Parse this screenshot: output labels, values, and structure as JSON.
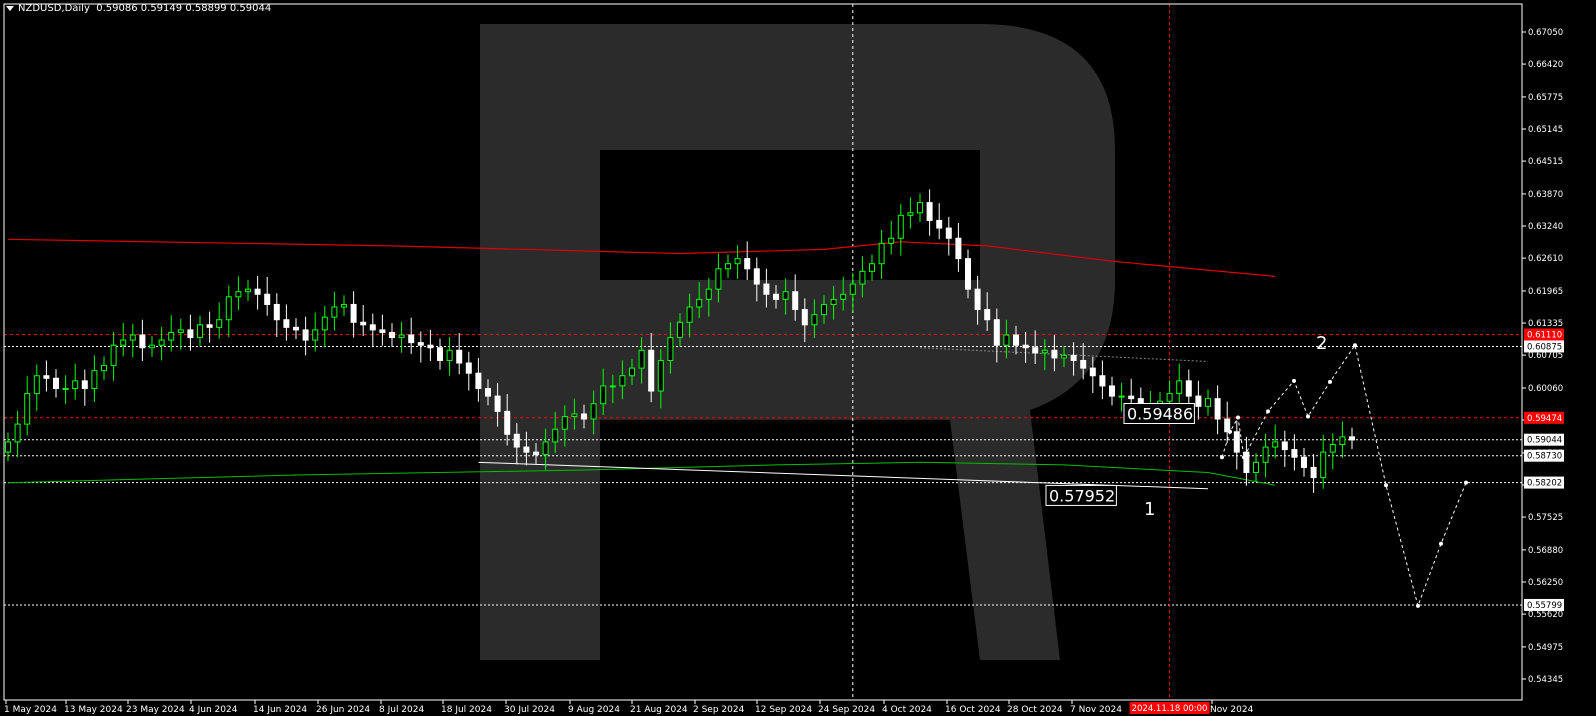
{
  "header": {
    "symbol": "NZDUSD,Daily",
    "ohlc": "0.59086 0.59149 0.58899 0.59044"
  },
  "colors": {
    "background": "#000000",
    "bull_candle": "#00ff00",
    "bear_candle": "#ffffff",
    "ma_long": "#e00000",
    "ma_mid": "#00c000",
    "red_level": "#ff0000",
    "axis_text": "#ffffff",
    "watermark": "#2b2b2b"
  },
  "chart_data": {
    "type": "candlestick",
    "ylim": [
      0.54345,
      0.6705
    ],
    "y_ticks": [
      "0.67050",
      "0.66420",
      "0.65775",
      "0.65145",
      "0.64515",
      "0.63870",
      "0.63240",
      "0.62610",
      "0.61965",
      "0.61335",
      "0.60705",
      "0.60060",
      "0.59430",
      "0.58785",
      "0.58155",
      "0.57525",
      "0.56880",
      "0.56250",
      "0.55620",
      "0.54975",
      "0.54345"
    ],
    "x_ticks": [
      "1 May 2024",
      "13 May 2024",
      "23 May 2024",
      "4 Jun 2024",
      "14 Jun 2024",
      "26 Jun 2024",
      "8 Jul 2024",
      "18 Jul 2024",
      "30 Jul 2024",
      "9 Aug 2024",
      "21 Aug 2024",
      "2 Sep 2024",
      "12 Sep 2024",
      "24 Sep 2024",
      "4 Oct 2024",
      "16 Oct 2024",
      "28 Oct 2024",
      "7 Nov 2024",
      "Nov 2024"
    ],
    "cursor_date_label": "2024.11.18 00:00",
    "price_labels": [
      {
        "value": 0.6111,
        "text": "0.61110",
        "style": "red"
      },
      {
        "value": 0.60875,
        "text": "0.60875",
        "style": "white"
      },
      {
        "value": 0.59474,
        "text": "0.59474",
        "style": "red"
      },
      {
        "value": 0.59044,
        "text": "0.59044",
        "style": "white"
      },
      {
        "value": 0.5873,
        "text": "0.58730",
        "style": "white"
      },
      {
        "value": 0.58202,
        "text": "0.58202",
        "style": "white"
      },
      {
        "value": 0.55799,
        "text": "0.55799",
        "style": "white"
      }
    ],
    "annotations": [
      {
        "text": "0.59486",
        "kind": "box"
      },
      {
        "text": "0.57952",
        "kind": "box"
      },
      {
        "text": "2",
        "kind": "wave"
      },
      {
        "text": "1",
        "kind": "wave"
      }
    ],
    "levels": [
      0.6111,
      0.60875,
      0.59474,
      0.5873,
      0.58202,
      0.55799
    ],
    "ma_red": [
      [
        0,
        0.6298
      ],
      [
        40,
        0.6285
      ],
      [
        70,
        0.627
      ],
      [
        85,
        0.6278
      ],
      [
        93,
        0.6293
      ],
      [
        102,
        0.6285
      ],
      [
        115,
        0.6255
      ],
      [
        132,
        0.6225
      ]
    ],
    "ma_green": [
      [
        0,
        0.582
      ],
      [
        30,
        0.5835
      ],
      [
        60,
        0.5845
      ],
      [
        80,
        0.5855
      ],
      [
        95,
        0.586
      ],
      [
        110,
        0.5855
      ],
      [
        125,
        0.584
      ],
      [
        132,
        0.5815
      ]
    ],
    "close": [
      0.59,
      0.5935,
      0.5995,
      0.603,
      0.6025,
      0.6005,
      0.6005,
      0.602,
      0.6005,
      0.604,
      0.605,
      0.609,
      0.61,
      0.611,
      0.6085,
      0.609,
      0.61,
      0.6115,
      0.612,
      0.6105,
      0.613,
      0.6125,
      0.614,
      0.6185,
      0.6195,
      0.62,
      0.619,
      0.617,
      0.614,
      0.6125,
      0.612,
      0.61,
      0.612,
      0.6145,
      0.6165,
      0.617,
      0.6135,
      0.613,
      0.612,
      0.6115,
      0.6105,
      0.611,
      0.6095,
      0.609,
      0.6085,
      0.606,
      0.608,
      0.6055,
      0.6035,
      0.6005,
      0.599,
      0.596,
      0.5915,
      0.589,
      0.588,
      0.5875,
      0.59,
      0.5925,
      0.595,
      0.5955,
      0.5945,
      0.5975,
      0.601,
      0.601,
      0.603,
      0.6045,
      0.608,
      0.6,
      0.606,
      0.6105,
      0.6135,
      0.6165,
      0.618,
      0.62,
      0.624,
      0.625,
      0.626,
      0.624,
      0.621,
      0.619,
      0.618,
      0.6195,
      0.616,
      0.613,
      0.615,
      0.617,
      0.618,
      0.619,
      0.621,
      0.6235,
      0.625,
      0.629,
      0.63,
      0.6345,
      0.635,
      0.637,
      0.6335,
      0.632,
      0.63,
      0.626,
      0.62,
      0.616,
      0.614,
      0.609,
      0.611,
      0.609,
      0.6085,
      0.6075,
      0.608,
      0.6065,
      0.607,
      0.606,
      0.6045,
      0.603,
      0.601,
      0.599,
      0.599,
      0.5985,
      0.597,
      0.597,
      0.598,
      0.5995,
      0.602,
      0.599,
      0.597,
      0.5985,
      0.5945,
      0.592,
      0.588,
      0.584,
      0.586,
      0.589,
      0.59,
      0.5885,
      0.587,
      0.585,
      0.583,
      0.588,
      0.5895,
      0.591,
      0.5904
    ],
    "forecast": [
      0.587,
      0.592,
      0.5948,
      0.587,
      0.596,
      0.602,
      0.595,
      0.6018,
      0.609,
      0.5815,
      0.5578,
      0.57,
      0.582
    ]
  },
  "watermark": "R"
}
